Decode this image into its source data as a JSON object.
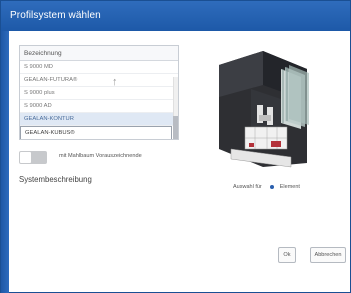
{
  "dialog": {
    "title": "Profilsystem wählen"
  },
  "list": {
    "header": "Bezeichnung",
    "sort_icon": "arrow-up-icon",
    "rows": [
      {
        "label": "S 9000 MD"
      },
      {
        "label": "GEALAN-FUTURA®"
      },
      {
        "label": "S 9000 plus"
      },
      {
        "label": "S 9000 AD"
      },
      {
        "label": "GEALAN-KONTUR"
      },
      {
        "label": "GEALAN-KUBUS®"
      }
    ],
    "selected_index": 4
  },
  "toggle": {
    "label": "mit Mahlbaum Vorauszeichnende",
    "state": "off"
  },
  "system_description": {
    "heading": "Systembeschreibung"
  },
  "assignment": {
    "label": "Auswahl für",
    "option": "Element"
  },
  "buttons": {
    "ok": "Ok",
    "cancel": "Abbrechen"
  },
  "colors": {
    "title_bar": "#2f6cbc",
    "accent": "#2a5fae",
    "selected_row": "#dfe8f4"
  }
}
